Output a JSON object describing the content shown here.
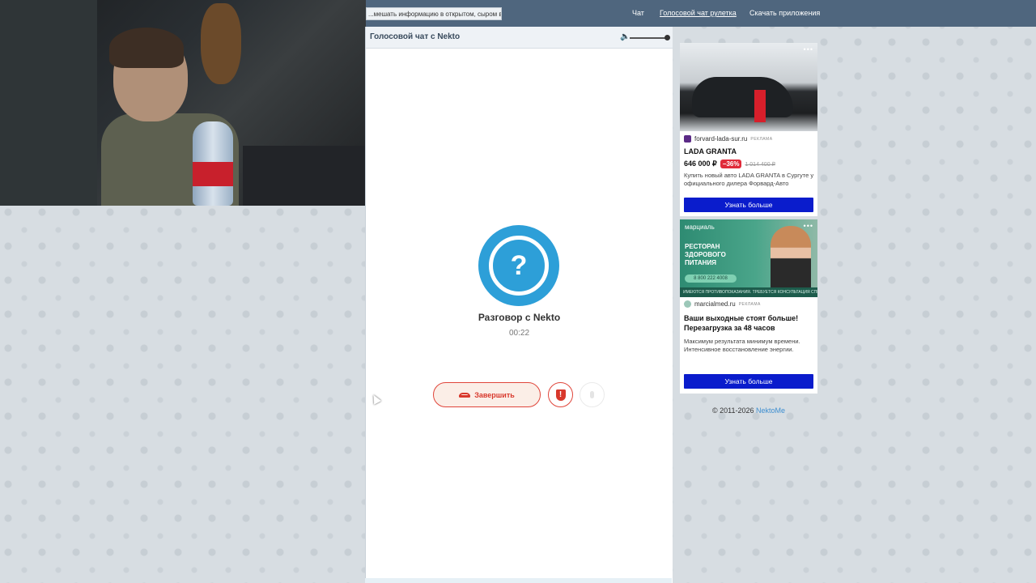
{
  "topbar": {
    "notice": "...мешать информацию в открытом, сыром виде!",
    "nav": [
      "Чат",
      "Голосовой чат рулетка",
      "Скачать приложения"
    ],
    "active_nav": "Голосовой чат рулетка"
  },
  "chat": {
    "header_title": "Голосовой чат с Nekto",
    "volume_icon": "speaker-icon",
    "avatar_symbol": "?",
    "conversation_title": "Разговор с Nekto",
    "timer": "00:22",
    "end_button": "Завершить",
    "report_icon_text": "!"
  },
  "ads": [
    {
      "source": "forvard-lada-sur.ru",
      "tag": "РЕКЛАМА",
      "title": "LADA GRANTA",
      "price_now": "646 000 ₽",
      "discount": "−36%",
      "price_old": "1 014 400 ₽",
      "description": "Купить новый авто LADA GRANTA в Сургуте у официального дилера Форвард-Авто",
      "button": "Узнать больше"
    },
    {
      "brand": "марциаль",
      "image_headline": "РЕСТОРАН ЗДОРОВОГО ПИТАНИЯ",
      "image_phone": "8 800 222 4008",
      "image_strip": "ИМЕЮТСЯ ПРОТИВОПОКАЗАНИЯ. ТРЕБУЕТСЯ КОНСУЛЬТАЦИЯ СПЕЦИАЛИСТА",
      "source": "marcialmed.ru",
      "tag": "РЕКЛАМА",
      "title": "Ваши выходные стоят больше! Перезагрузка за 48 часов",
      "description": "Максимум результата минимум времени. Интенсивное восстановление энергии.",
      "button": "Узнать больше"
    }
  ],
  "ad_more": "•••",
  "footer": {
    "copyright": "© 2011-2026",
    "link": "NektoMe"
  },
  "colors": {
    "topbar": "#4f667e",
    "avatar": "#2d9fd8",
    "end_button": "#e0453a",
    "ad_button": "#0a1ccc",
    "discount": "#e02a3a"
  }
}
